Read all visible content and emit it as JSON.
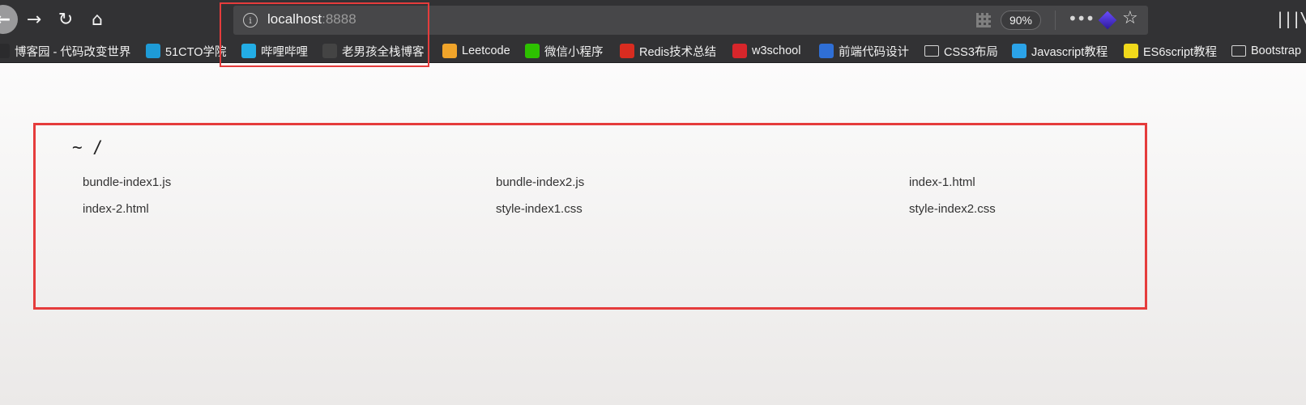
{
  "browser": {
    "url_host": "localhost",
    "url_port": ":8888",
    "zoom": "90%"
  },
  "bookmarks": [
    {
      "label": "博客园 - 代码改变世界",
      "icon": "cnblogs-icon",
      "color": "#2b2b2d"
    },
    {
      "label": "51CTO学院",
      "icon": "51cto-icon",
      "color": "#1e9bd7"
    },
    {
      "label": "哔哩哔哩",
      "icon": "bilibili-icon",
      "color": "#23ade5"
    },
    {
      "label": "老男孩全栈博客",
      "icon": "oldboy-icon",
      "color": "#444444"
    },
    {
      "label": "Leetcode",
      "icon": "leetcode-icon",
      "color": "#f0a42a"
    },
    {
      "label": "微信小程序",
      "icon": "wechat-icon",
      "color": "#2dc100"
    },
    {
      "label": "Redis技术总结",
      "icon": "redis-icon",
      "color": "#d82c20"
    },
    {
      "label": "w3school",
      "icon": "w3school-icon",
      "color": "#d7262b"
    },
    {
      "label": "前端代码设计",
      "icon": "frontend-icon",
      "color": "#2f6fd6"
    },
    {
      "label": "CSS3布局",
      "icon": "folder-icon",
      "color": ""
    },
    {
      "label": "Javascript教程",
      "icon": "javascript-icon",
      "color": "#2ba3e8"
    },
    {
      "label": "ES6script教程",
      "icon": "es6-icon",
      "color": "#f0d91b"
    },
    {
      "label": "Bootstrap",
      "icon": "folder-icon",
      "color": ""
    }
  ],
  "page": {
    "path": "~ /",
    "files": [
      "bundle-index1.js",
      "bundle-index2.js",
      "index-1.html",
      "index-2.html",
      "style-index1.css",
      "style-index2.css"
    ]
  }
}
